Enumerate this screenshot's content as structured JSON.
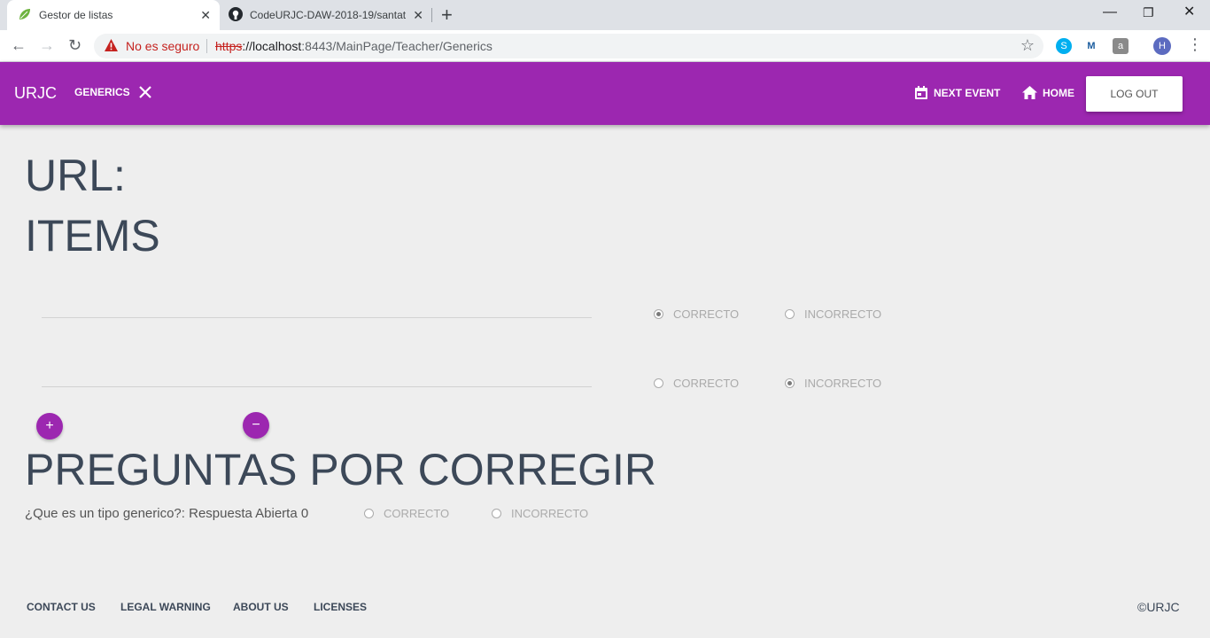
{
  "browser": {
    "tabs": [
      {
        "title": "Gestor de listas",
        "icon": "leaf-icon"
      },
      {
        "title": "CodeURJC-DAW-2018-19/santat",
        "icon": "github-icon"
      }
    ],
    "security_label": "No es seguro",
    "url": {
      "scheme": "https",
      "host": "://localhost",
      "rest": ":8443/MainPage/Teacher/Generics"
    },
    "profile_initial": "H"
  },
  "nav": {
    "brand": "URJC",
    "current_section": "GENERICS",
    "links": {
      "next_event": "NEXT EVENT",
      "home": "HOME"
    },
    "logout": "LOG OUT",
    "accent_color": "#9c27b0"
  },
  "main": {
    "url_heading": "URL:",
    "items_heading": "ITEMS",
    "items": [
      {
        "value": "",
        "options": [
          "CORRECTO",
          "INCORRECTO"
        ],
        "selected": "CORRECTO"
      },
      {
        "value": "",
        "options": [
          "CORRECTO",
          "INCORRECTO"
        ],
        "selected": "INCORRECTO"
      }
    ],
    "add_button": "+",
    "remove_button": "−",
    "pending_heading": "PREGUNTAS POR CORREGIR",
    "pending": [
      {
        "question": "¿Que es un tipo generico?: Respuesta Abierta 0",
        "options": [
          "CORRECTO",
          "INCORRECTO"
        ],
        "selected": null
      }
    ]
  },
  "footer": {
    "links": [
      "CONTACT US",
      "LEGAL WARNING",
      "ABOUT US",
      "LICENSES"
    ],
    "copyright": "©URJC"
  }
}
